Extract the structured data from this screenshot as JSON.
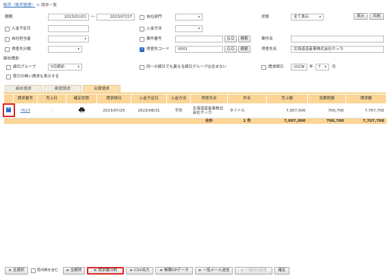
{
  "breadcrumb": {
    "parent": "販売（販売管理）",
    "separator": ">",
    "current": "請求一覧"
  },
  "search": {
    "period_label": "期間",
    "date_from": "2023/01/01",
    "range_sep": "～",
    "date_to": "2023/07/27",
    "dept_label": "自社部門",
    "status_label": "状態",
    "status_value": "全て表示",
    "show_button": "表示",
    "print_button": "印刷",
    "deposit_date_label": "入金予定日",
    "payment_method_label": "入金方法",
    "staff_label": "自社担当者",
    "case_no_label": "案件番号",
    "go_label": "ＧＯ",
    "search_label": "検索",
    "case_name_label": "案件名",
    "client_class_label": "得意先分類",
    "client_code_label": "得意先コード",
    "client_code_value": "0001",
    "client_name_label": "得意先名",
    "client_name_value": "北海道道産事株式会社ホッカ",
    "closing_label": "締め請求:",
    "closing_group_label": "締日グループ",
    "closing_group_value": "5日締め",
    "same_closing_label": "同一の締日でも異なる締日グループは含まない",
    "billing_closing_label": "請求締日",
    "year_value": "2023",
    "year_unit": "年",
    "month_value": "7",
    "month_unit": "月",
    "no_transaction_label": "取引の無い請求も表示する"
  },
  "tabs": [
    {
      "label": "締め請求"
    },
    {
      "label": "都度請求"
    },
    {
      "label": "合算請求"
    }
  ],
  "table": {
    "headers": [
      "",
      "請求番号",
      "売上日",
      "確定状態",
      "請求締日",
      "入金予定日",
      "入金方法",
      "得意先名",
      "件名",
      "売上額",
      "消費税額",
      "請求額"
    ],
    "rows": [
      {
        "invoice_no": "7623",
        "sales_date": "-",
        "status_icon": "printer-icon",
        "closing_date": "2023/07/25",
        "deposit_date": "2023/08/31",
        "method": "手形",
        "client": "北海道道産事株式会社ホッカ",
        "subject": "タイトル",
        "sales": "7,007,000",
        "tax": "700,700",
        "billing": "7,707,700"
      }
    ],
    "total": {
      "label": "合計",
      "count": "1 件",
      "sales": "7,007,000",
      "tax": "700,700",
      "billing": "7,707,700"
    }
  },
  "footer": {
    "select_all": "全選択",
    "include_unprinted": "再印刷を含む",
    "deselect_all": "全解除",
    "print_invoice": "請求書印刷",
    "csv_export": "CSV出力",
    "obc_data": "帳票OPデータ",
    "bulk_mail": "一括メール送信",
    "bulk_edi": "一括EDI送信",
    "confirm": "確定"
  }
}
